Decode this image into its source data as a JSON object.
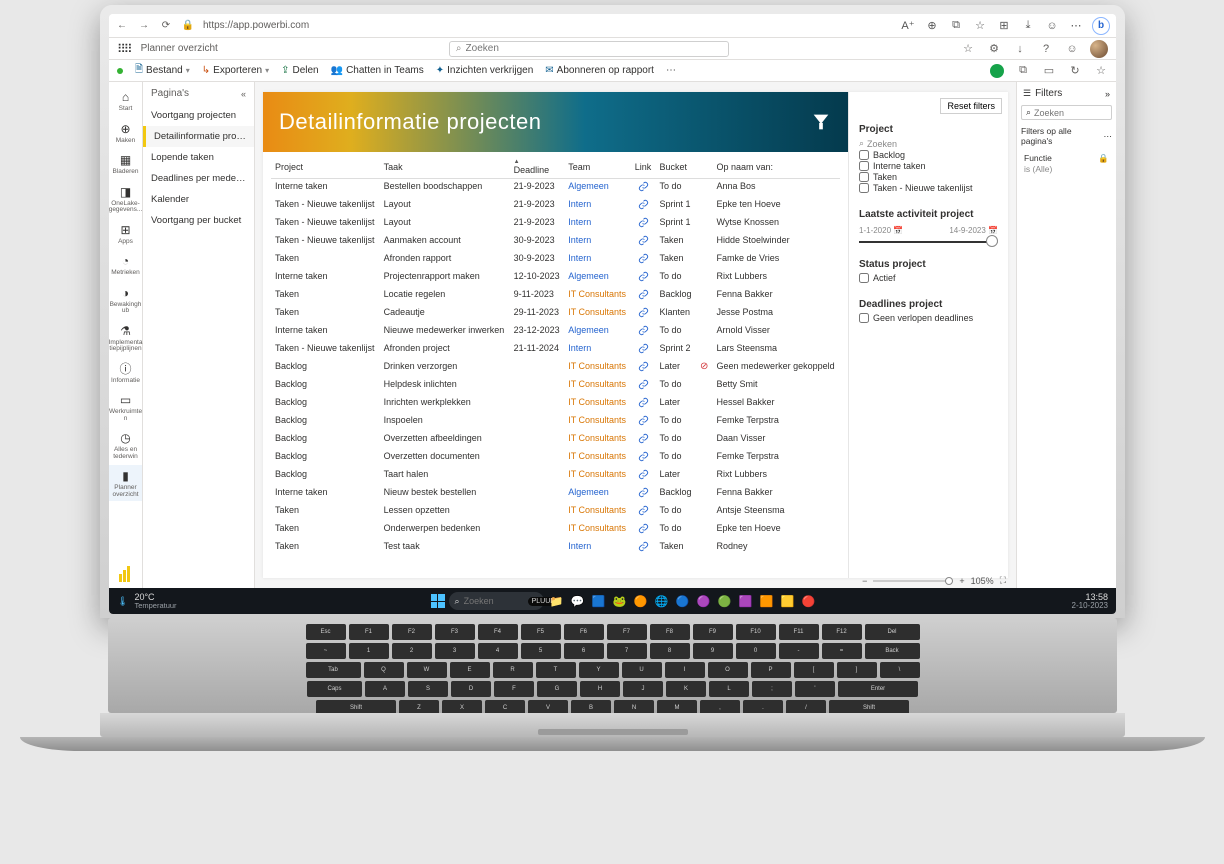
{
  "browser": {
    "url": "https://app.powerbi.com",
    "back": "←",
    "forward": "→",
    "refresh": "⟳",
    "lock": "🔒"
  },
  "topbar": {
    "breadcrumb": "Planner overzicht",
    "search_ph": "Zoeken",
    "icons": [
      "☆",
      "⚙",
      "↓",
      "?",
      "✉"
    ]
  },
  "cmd": {
    "bestand": "Bestand",
    "exporteren": "Exporteren",
    "delen": "Delen",
    "teams": "Chatten in Teams",
    "inzicht": "Inzichten verkrijgen",
    "abon": "Abonneren op rapport"
  },
  "rail": [
    {
      "ico": "⌂",
      "lbl": "Start"
    },
    {
      "ico": "⊕",
      "lbl": "Maken"
    },
    {
      "ico": "▦",
      "lbl": "Bladeren"
    },
    {
      "ico": "◨",
      "lbl": "OneLake-gegevens..."
    },
    {
      "ico": "⊞",
      "lbl": "Apps"
    },
    {
      "ico": "◔",
      "lbl": "Metrieken"
    },
    {
      "ico": "◑",
      "lbl": "Bewakingh ub"
    },
    {
      "ico": "⚗",
      "lbl": "Implementa tiepijplijnen"
    },
    {
      "ico": "ⓘ",
      "lbl": "Informatie"
    },
    {
      "ico": "▭",
      "lbl": "Werkruimte n"
    },
    {
      "ico": "◷",
      "lbl": "Alles en tederwin"
    },
    {
      "ico": "▮",
      "lbl": "Planner overzicht",
      "active": true
    }
  ],
  "pages": {
    "title": "Pagina's",
    "items": [
      "Voortgang projecten",
      "Detailinformatie projec...",
      "Lopende taken",
      "Deadlines per medewer...",
      "Kalender",
      "Voortgang per bucket"
    ],
    "active": 1
  },
  "hero": "Detailinformatie projecten",
  "table": {
    "cols": [
      "Project",
      "Taak",
      "Deadline",
      "Team",
      "Link",
      "Bucket",
      "",
      "Op naam van:"
    ],
    "rows": [
      [
        "Interne taken",
        "Bestellen boodschappen",
        "21-9-2023",
        "Algemeen",
        "l",
        "To do",
        "",
        "Anna Bos"
      ],
      [
        "Taken - Nieuwe takenlijst",
        "Layout",
        "21-9-2023",
        "Intern",
        "l",
        "Sprint 1",
        "",
        "Epke ten Hoeve"
      ],
      [
        "Taken - Nieuwe takenlijst",
        "Layout",
        "21-9-2023",
        "Intern",
        "l",
        "Sprint 1",
        "",
        "Wytse Knossen"
      ],
      [
        "Taken - Nieuwe takenlijst",
        "Aanmaken account",
        "30-9-2023",
        "Intern",
        "l",
        "Taken",
        "",
        "Hidde Stoelwinder"
      ],
      [
        "Taken",
        "Afronden rapport",
        "30-9-2023",
        "Intern",
        "l",
        "Taken",
        "",
        "Famke de Vries"
      ],
      [
        "Interne taken",
        "Projectenrapport maken",
        "12-10-2023",
        "Algemeen",
        "l",
        "To do",
        "",
        "Rixt Lubbers"
      ],
      [
        "Taken",
        "Locatie regelen",
        "9-11-2023",
        "IT Consultants",
        "l",
        "Backlog",
        "",
        "Fenna Bakker"
      ],
      [
        "Taken",
        "Cadeautje",
        "29-11-2023",
        "IT Consultants",
        "l",
        "Klanten",
        "",
        "Jesse Postma"
      ],
      [
        "Interne taken",
        "Nieuwe medewerker inwerken",
        "23-12-2023",
        "Algemeen",
        "l",
        "To do",
        "",
        "Arnold Visser"
      ],
      [
        "Taken - Nieuwe takenlijst",
        "Afronden project",
        "21-11-2024",
        "Intern",
        "l",
        "Sprint 2",
        "",
        "Lars Steensma"
      ],
      [
        "Backlog",
        "Drinken verzorgen",
        "",
        "IT Consultants",
        "l",
        "Later",
        "x",
        "Geen medewerker gekoppeld"
      ],
      [
        "Backlog",
        "Helpdesk inlichten",
        "",
        "IT Consultants",
        "l",
        "To do",
        "",
        "Betty Smit"
      ],
      [
        "Backlog",
        "Inrichten werkplekken",
        "",
        "IT Consultants",
        "l",
        "Later",
        "",
        "Hessel Bakker"
      ],
      [
        "Backlog",
        "Inspoelen",
        "",
        "IT Consultants",
        "l",
        "To do",
        "",
        "Femke Terpstra"
      ],
      [
        "Backlog",
        "Overzetten afbeeldingen",
        "",
        "IT Consultants",
        "l",
        "To do",
        "",
        "Daan Visser"
      ],
      [
        "Backlog",
        "Overzetten documenten",
        "",
        "IT Consultants",
        "l",
        "To do",
        "",
        "Femke Terpstra"
      ],
      [
        "Backlog",
        "Taart halen",
        "",
        "IT Consultants",
        "l",
        "Later",
        "",
        "Rixt Lubbers"
      ],
      [
        "Interne taken",
        "Nieuw bestek bestellen",
        "",
        "Algemeen",
        "l",
        "Backlog",
        "",
        "Fenna Bakker"
      ],
      [
        "Taken",
        "Lessen opzetten",
        "",
        "IT Consultants",
        "l",
        "To do",
        "",
        "Antsje Steensma"
      ],
      [
        "Taken",
        "Onderwerpen bedenken",
        "",
        "IT Consultants",
        "l",
        "To do",
        "",
        "Epke ten Hoeve"
      ],
      [
        "Taken",
        "Test taak",
        "",
        "Intern",
        "l",
        "Taken",
        "",
        "Rodney"
      ]
    ]
  },
  "slicers": {
    "reset": "Reset filters",
    "project": "Project",
    "zoeken": "Zoeken",
    "projOpts": [
      "Backlog",
      "Interne taken",
      "Taken",
      "Taken - Nieuwe takenlijst"
    ],
    "act": "Laatste activiteit project",
    "actFrom": "1-1-2020",
    "actTo": "14-9-2023",
    "status": "Status project",
    "statusOpt": "Actief",
    "dead": "Deadlines project",
    "deadOpt": "Geen verlopen deadlines"
  },
  "filters": {
    "title": "Filters",
    "search": "Zoeken",
    "section": "Filters op alle pagina's",
    "f1": "Functie",
    "f1v": "is (Alle)"
  },
  "zoom": {
    "pct": "105%"
  },
  "taskbar": {
    "wtemp": "20°C",
    "wtxt": "Temperatuur",
    "search": "Zoeken",
    "pill": "PLUUR",
    "apps": [
      "📁",
      "💬",
      "🟦",
      "🐸",
      "🟠",
      "🌐",
      "🔵",
      "🟣",
      "🟢",
      "🟪",
      "🟧",
      "🟨",
      "🔴"
    ],
    "time": "13:58",
    "date": "2-10-2023"
  }
}
